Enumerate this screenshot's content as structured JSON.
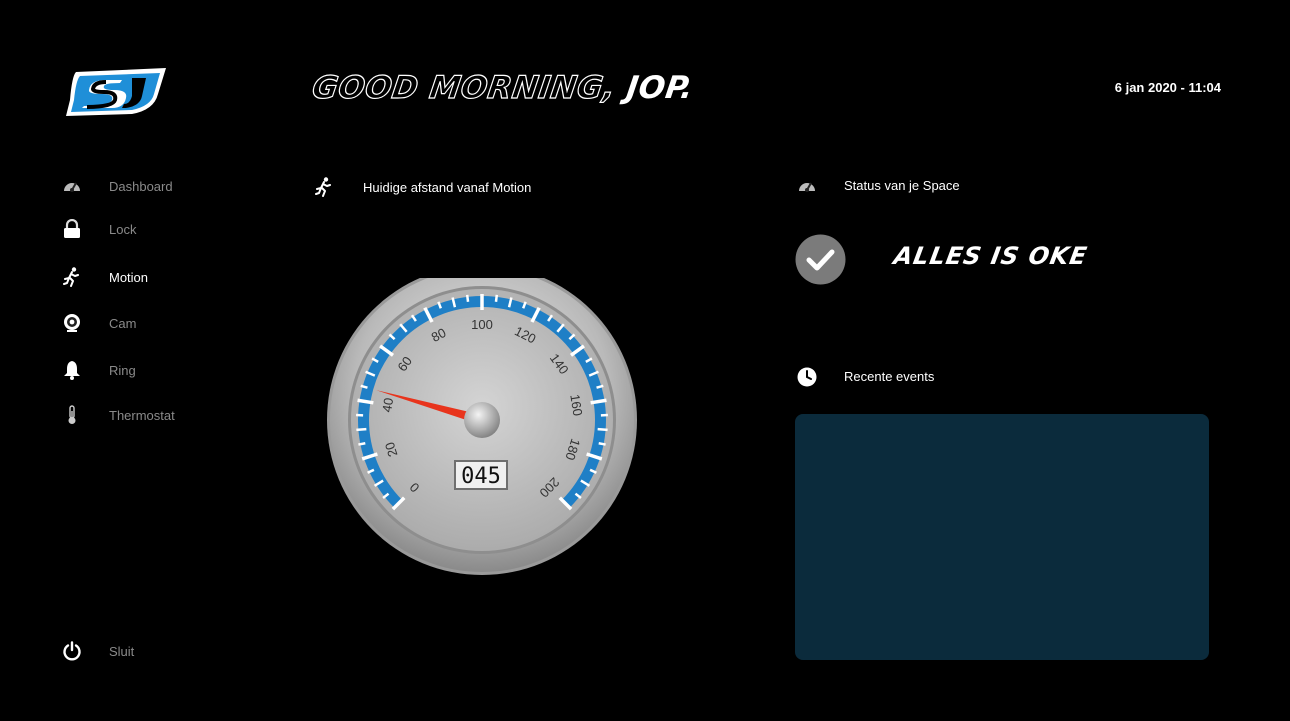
{
  "header": {
    "greeting_prefix": "GOOD MORNING,",
    "greeting_name": "JOP.",
    "datetime": "6 jan 2020  -  11:04"
  },
  "sidebar": {
    "items": [
      {
        "label": "Dashboard",
        "icon": "gauge-icon",
        "active": false
      },
      {
        "label": "Lock",
        "icon": "lock-icon",
        "active": false
      },
      {
        "label": "Motion",
        "icon": "running-person-icon",
        "active": true
      },
      {
        "label": "Cam",
        "icon": "webcam-icon",
        "active": false
      },
      {
        "label": "Ring",
        "icon": "bell-icon",
        "active": false
      },
      {
        "label": "Thermostat",
        "icon": "thermometer-icon",
        "active": false
      }
    ],
    "footer": {
      "label": "Sluit",
      "icon": "power-icon"
    }
  },
  "motion": {
    "title": "Huidige afstand vanaf Motion",
    "gauge": {
      "value": 45,
      "odometer": "045",
      "min": 0,
      "max": 200,
      "tick_labels": [
        "0",
        "20",
        "40",
        "60",
        "80",
        "100",
        "120",
        "140",
        "160",
        "180",
        "200"
      ],
      "needle_color": "#e8341c",
      "scale_color": "#1f7fc6"
    }
  },
  "status": {
    "title": "Status van je Space",
    "text": "ALLES IS OKE"
  },
  "events": {
    "title": "Recente events",
    "items": []
  },
  "colors": {
    "background": "#000000",
    "panel": "#0b2b3c",
    "brand_blue": "#1f7fc6"
  }
}
